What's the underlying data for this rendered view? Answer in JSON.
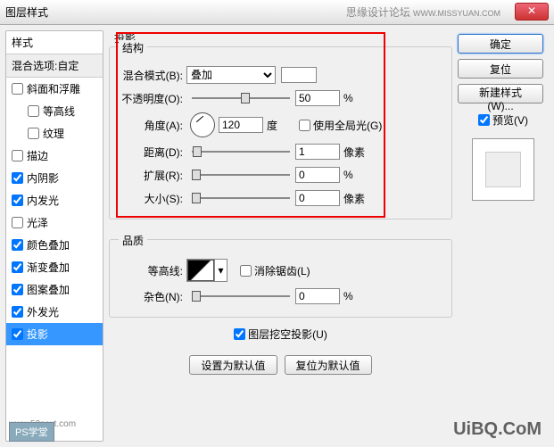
{
  "window": {
    "title": "图层样式",
    "forum_text": "思缘设计论坛",
    "forum_url": "WWW.MISSYUAN.COM"
  },
  "left": {
    "header": "样式",
    "blend_options": "混合选项:自定",
    "items": [
      {
        "label": "斜面和浮雕",
        "checked": false,
        "indent": false
      },
      {
        "label": "等高线",
        "checked": false,
        "indent": true
      },
      {
        "label": "纹理",
        "checked": false,
        "indent": true
      },
      {
        "label": "描边",
        "checked": false,
        "indent": false
      },
      {
        "label": "内阴影",
        "checked": true,
        "indent": false
      },
      {
        "label": "内发光",
        "checked": true,
        "indent": false
      },
      {
        "label": "光泽",
        "checked": false,
        "indent": false
      },
      {
        "label": "颜色叠加",
        "checked": true,
        "indent": false
      },
      {
        "label": "渐变叠加",
        "checked": true,
        "indent": false
      },
      {
        "label": "图案叠加",
        "checked": true,
        "indent": false
      },
      {
        "label": "外发光",
        "checked": true,
        "indent": false
      },
      {
        "label": "投影",
        "checked": true,
        "indent": false,
        "selected": true
      }
    ]
  },
  "mid": {
    "section_title": "投影",
    "structure": {
      "legend": "结构",
      "blend_mode_label": "混合模式(B):",
      "blend_mode_value": "叠加",
      "opacity_label": "不透明度(O):",
      "opacity_value": "50",
      "opacity_unit": "%",
      "angle_label": "角度(A):",
      "angle_value": "120",
      "angle_unit": "度",
      "global_light_label": "使用全局光(G)",
      "global_light_checked": false,
      "distance_label": "距离(D):",
      "distance_value": "1",
      "distance_unit": "像素",
      "spread_label": "扩展(R):",
      "spread_value": "0",
      "spread_unit": "%",
      "size_label": "大小(S):",
      "size_value": "0",
      "size_unit": "像素"
    },
    "quality": {
      "legend": "品质",
      "contour_label": "等高线:",
      "antialias_label": "消除锯齿(L)",
      "antialias_checked": false,
      "noise_label": "杂色(N):",
      "noise_value": "0",
      "noise_unit": "%"
    },
    "knockout_label": "图层挖空投影(U)",
    "knockout_checked": true,
    "btn_make_default": "设置为默认值",
    "btn_reset_default": "复位为默认值"
  },
  "right": {
    "ok": "确定",
    "cancel": "复位",
    "new_style": "新建样式(W)...",
    "preview_label": "预览(V)",
    "preview_checked": true
  },
  "footer": {
    "badge": "PS学堂",
    "badge_url": "www.52psxt.com",
    "watermark": "UiBQ.CoM"
  }
}
